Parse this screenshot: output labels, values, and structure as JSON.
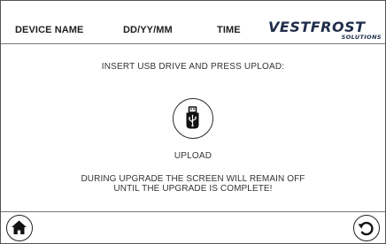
{
  "header": {
    "device_name": "DEVICE NAME",
    "date_format": "DD/YY/MM",
    "time": "TIME",
    "logo": {
      "main": "VESTFROST",
      "sub": "SOLUTIONS"
    }
  },
  "main": {
    "instruction": "INSERT USB DRIVE AND PRESS UPLOAD:",
    "upload_icon": "usb-drive-icon",
    "upload_label": "UPLOAD",
    "warning_line1": "DURING UPGRADE THE SCREEN WILL REMAIN OFF",
    "warning_line2": "UNTIL THE UPGRADE IS COMPLETE!"
  },
  "footer": {
    "home_icon": "home-icon",
    "back_icon": "back-arrow-icon"
  },
  "colors": {
    "logo": "#1f2d4a",
    "text": "#333333",
    "border": "#777777"
  }
}
